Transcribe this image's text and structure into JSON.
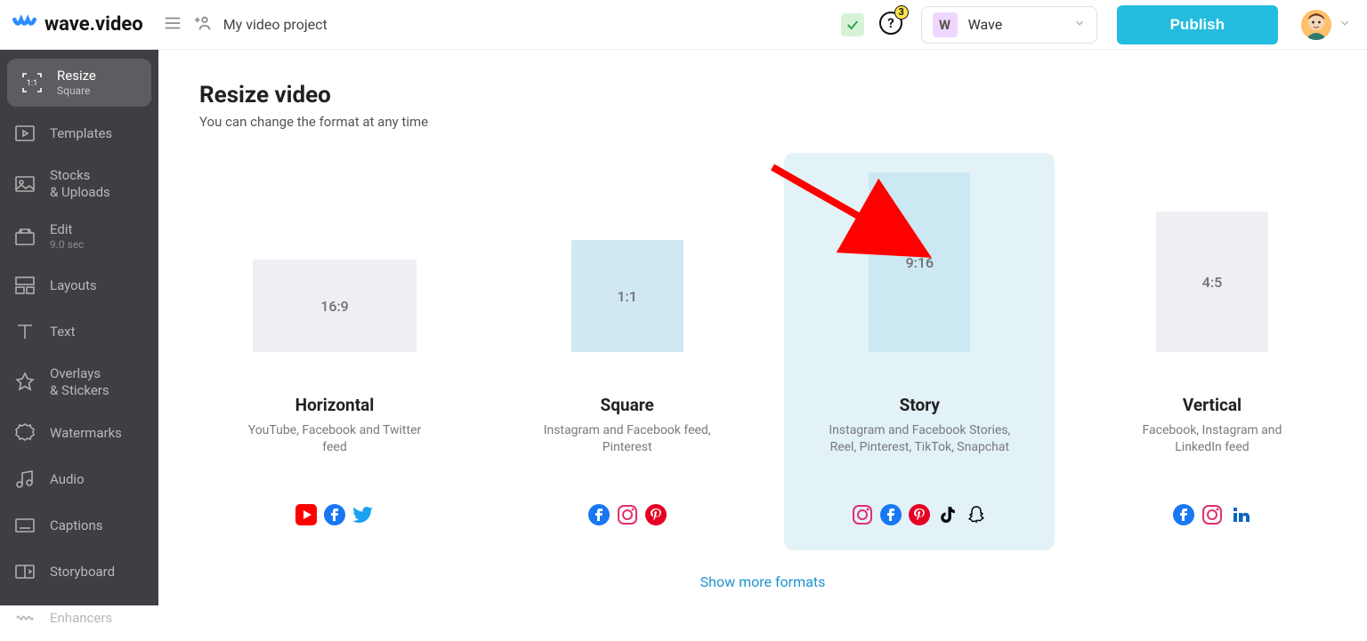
{
  "header": {
    "logo_text": "wave.video",
    "project_title": "My video project",
    "help_badge": "3",
    "brand_initial": "W",
    "brand_name": "Wave",
    "publish_label": "Publish"
  },
  "sidebar": {
    "resize": {
      "label": "Resize",
      "sub": "Square",
      "icon_text": "1:1"
    },
    "templates": {
      "label": "Templates"
    },
    "stocks": {
      "label": "Stocks",
      "sub": "& Uploads"
    },
    "edit": {
      "label": "Edit",
      "sub": "9.0 sec"
    },
    "layouts": {
      "label": "Layouts"
    },
    "text": {
      "label": "Text"
    },
    "overlays": {
      "label": "Overlays",
      "sub": "& Stickers"
    },
    "watermarks": {
      "label": "Watermarks"
    },
    "audio": {
      "label": "Audio"
    },
    "captions": {
      "label": "Captions"
    },
    "storyboard": {
      "label": "Storyboard"
    },
    "enhancers": {
      "label": "Enhancers"
    }
  },
  "main": {
    "title": "Resize video",
    "subtitle": "You can change the format at any time",
    "show_more": "Show more formats",
    "cards": {
      "horizontal": {
        "ratio": "16:9",
        "title": "Horizontal",
        "desc": "YouTube, Facebook and Twitter feed"
      },
      "square": {
        "ratio": "1:1",
        "title": "Square",
        "desc": "Instagram and Facebook feed, Pinterest"
      },
      "story": {
        "ratio": "9:16",
        "title": "Story",
        "desc": "Instagram and Facebook Stories, Reel, Pinterest, TikTok, Snapchat"
      },
      "vertical": {
        "ratio": "4:5",
        "title": "Vertical",
        "desc": "Facebook, Instagram and LinkedIn feed"
      }
    }
  }
}
